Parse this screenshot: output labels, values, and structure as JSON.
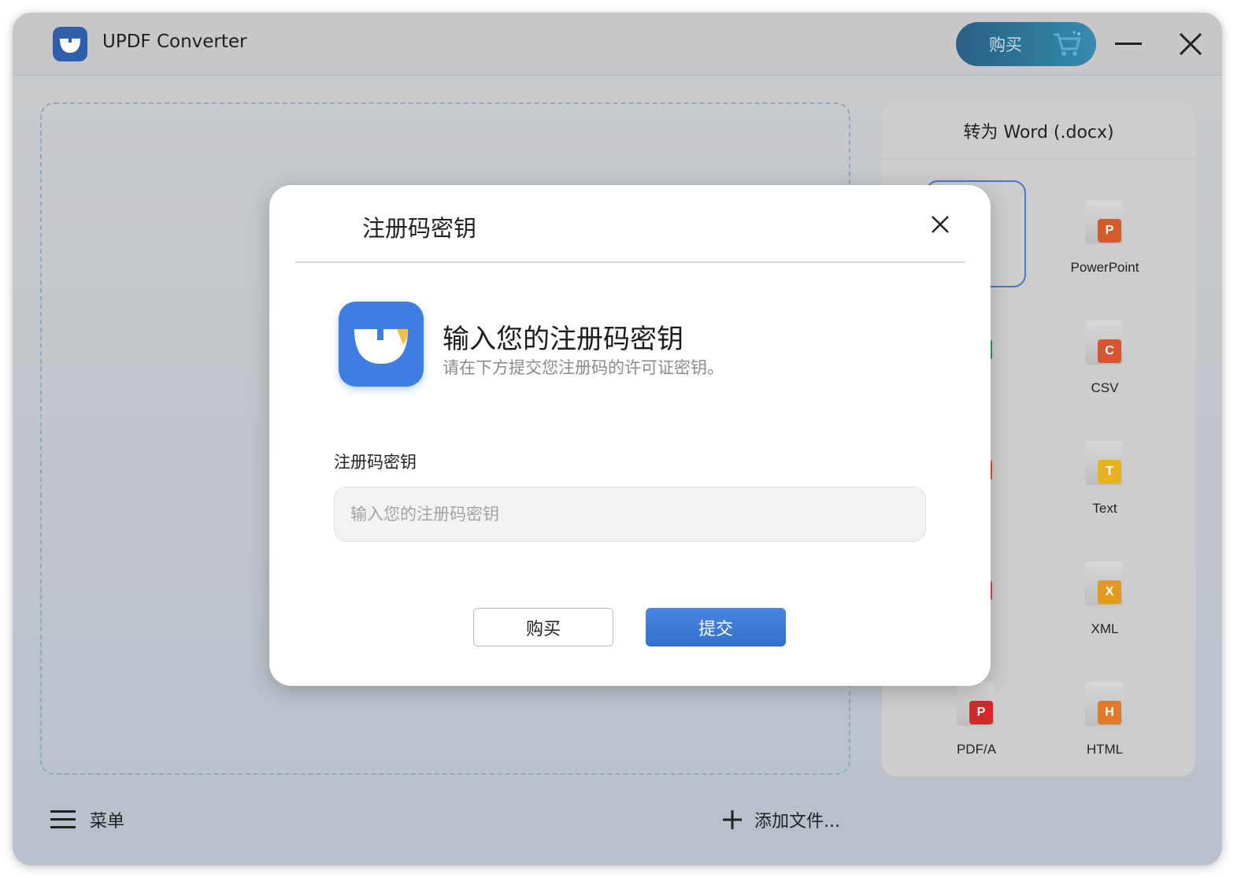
{
  "app": {
    "title": "UPDF Converter",
    "buy_label": "购买"
  },
  "panel": {
    "header": "转为 Word (.docx)",
    "formats": [
      {
        "label": "PowerPoint",
        "badge": "P",
        "color": "#d35a2a"
      },
      {
        "label": "CSV",
        "badge": "C",
        "color": "#d9542f"
      },
      {
        "label": "Text",
        "badge": "T",
        "color": "#e8b21e"
      },
      {
        "label": "XML",
        "badge": "X",
        "color": "#e39a1c"
      },
      {
        "label": "PDF/A",
        "badge": "P",
        "color": "#d02a2a"
      },
      {
        "label": "HTML",
        "badge": "H",
        "color": "#e07a27"
      }
    ]
  },
  "bottom": {
    "menu_label": "菜单",
    "add_label": "添加文件..."
  },
  "dialog": {
    "title": "注册码密钥",
    "heading": "输入您的注册码密钥",
    "subtitle": "请在下方提交您注册码的许可证密钥。",
    "field_label": "注册码密钥",
    "input_placeholder": "输入您的注册码密钥",
    "input_value": "",
    "buy_button": "购买",
    "submit_button": "提交"
  },
  "colors": {
    "accent": "#3d7ee0",
    "buy_pill": "#2e7ea0"
  }
}
